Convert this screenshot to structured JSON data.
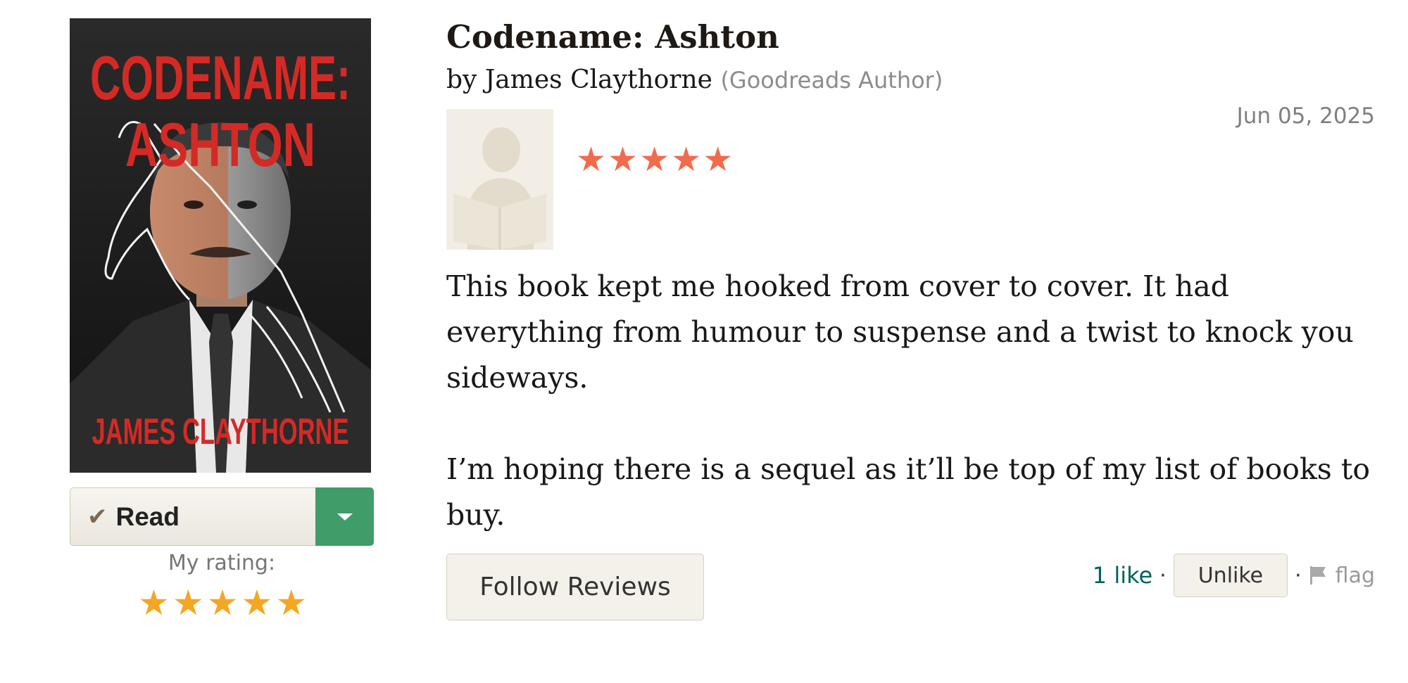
{
  "book": {
    "cover_title_line1": "CODENAME:",
    "cover_title_line2": "ASHTON",
    "cover_author": "JAMES CLAYTHORNE",
    "title": "Codename: Ashton",
    "by_label": "by",
    "author": "James Claythorne",
    "author_badge": "(Goodreads Author)"
  },
  "shelf": {
    "status_label": "Read",
    "check_icon": "checkmark-icon",
    "dropdown_icon": "caret-down-icon",
    "button_color": "#409d69"
  },
  "my_rating": {
    "label": "My rating:",
    "stars": 5,
    "max": 5,
    "color": "#f5a623"
  },
  "review": {
    "date": "Jun 05, 2025",
    "rating": 5,
    "max": 5,
    "star_color": "#f26b4d",
    "paragraphs": [
      "This book kept me hooked from cover to cover. It had everything from humour to suspense and a twist to knock you sideways.",
      "I’m hoping there is a sequel as it’ll be top of my list of books to buy."
    ]
  },
  "actions": {
    "follow_label": "Follow Reviews",
    "likes_label": "1 like",
    "separator": "·",
    "unlike_label": "Unlike",
    "flag_label": "flag"
  }
}
